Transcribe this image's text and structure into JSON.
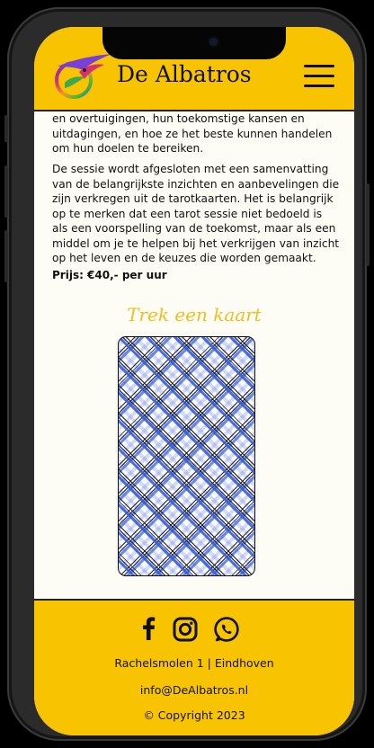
{
  "header": {
    "brand": "De Albatros"
  },
  "content": {
    "paragraph_1": "en overtuigingen, hun toekomstige kansen en uitdagingen, en hoe ze het beste kunnen handelen om hun doelen te bereiken.",
    "paragraph_2": "De sessie wordt afgesloten met een samenvatting van de belangrijkste inzichten en aanbevelingen die zijn verkregen uit de tarotkaarten. Het is belangrijk op te merken dat een tarot sessie niet bedoeld is als een voorspelling van de toekomst, maar als een middel om je te helpen bij het verkrijgen van inzicht op het leven en de keuzes die worden gemaakt.",
    "price": "Prijs: €40,- per uur",
    "draw_title": "Trek een kaart"
  },
  "footer": {
    "social": [
      "facebook-icon",
      "instagram-icon",
      "whatsapp-icon"
    ],
    "address": "Rachelsmolen 1 | Eindhoven",
    "email": "info@DeAlbatros.nl",
    "copyright": "© Copyright 2023"
  },
  "colors": {
    "accent": "#f8c301",
    "title": "#f1be1e",
    "background": "#fdfdf6",
    "card_blue": "#3a5cd0"
  }
}
